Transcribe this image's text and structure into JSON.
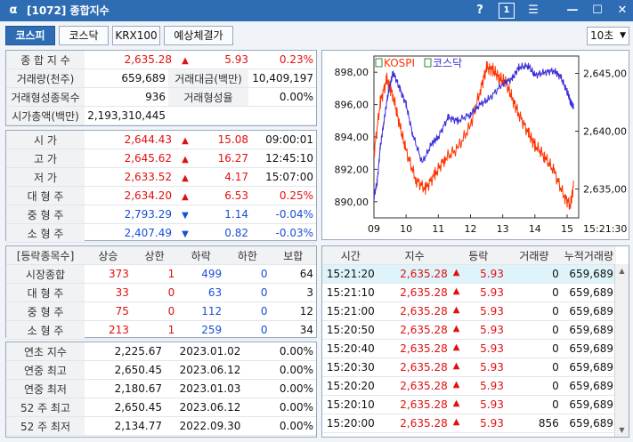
{
  "window": {
    "title": "[1072] 종합지수",
    "logo": "α",
    "help": "?",
    "num": "1",
    "menu": "☰",
    "min": "—",
    "max": "☐",
    "close": "✕"
  },
  "tabs": [
    {
      "label": "코스피"
    },
    {
      "label": "코스닥"
    },
    {
      "label": "KRX100"
    },
    {
      "label": "예상체결가"
    }
  ],
  "interval": {
    "value": "10초"
  },
  "summary": {
    "index_label": "종 합 지 수",
    "index_value": "2,635.28",
    "index_change": "5.93",
    "index_rate": "0.23%",
    "vol_label": "거래량(천주)",
    "vol_value": "659,689",
    "amt_label": "거래대금(백만)",
    "amt_value": "10,409,197",
    "form_cnt_label": "거래형성종목수",
    "form_cnt_value": "936",
    "form_rate_label": "거래형성율",
    "form_rate_value": "0.00%",
    "mcap_label": "시가총액(백만)",
    "mcap_value": "2,193,310,445"
  },
  "ohlc": [
    {
      "label": "시    가",
      "value": "2,644.43",
      "dir": "up",
      "change": "15.08",
      "extra": "09:00:01",
      "vcolor": "red",
      "ecolor": ""
    },
    {
      "label": "고    가",
      "value": "2,645.62",
      "dir": "up",
      "change": "16.27",
      "extra": "12:45:10",
      "vcolor": "red",
      "ecolor": ""
    },
    {
      "label": "저    가",
      "value": "2,633.52",
      "dir": "up",
      "change": "4.17",
      "extra": "15:07:00",
      "vcolor": "red",
      "ecolor": ""
    },
    {
      "label": "대 형 주",
      "value": "2,634.20",
      "dir": "up",
      "change": "6.53",
      "extra": "0.25%",
      "vcolor": "red",
      "ecolor": "red"
    },
    {
      "label": "중 형 주",
      "value": "2,793.29",
      "dir": "down",
      "change": "1.14",
      "extra": "-0.04%",
      "vcolor": "blue",
      "ecolor": "blue"
    },
    {
      "label": "소 형 주",
      "value": "2,407.49",
      "dir": "down",
      "change": "0.82",
      "extra": "-0.03%",
      "vcolor": "blue",
      "ecolor": "blue"
    }
  ],
  "breadth": {
    "headers": [
      "[등락종목수]",
      "상승",
      "상한",
      "하락",
      "하한",
      "보합"
    ],
    "rows": [
      {
        "label": "시장종합",
        "up": "373",
        "upper": "1",
        "down": "499",
        "lower": "0",
        "flat": "64"
      },
      {
        "label": "대 형 주",
        "up": "33",
        "upper": "0",
        "down": "63",
        "lower": "0",
        "flat": "3"
      },
      {
        "label": "중 형 주",
        "up": "75",
        "upper": "0",
        "down": "112",
        "lower": "0",
        "flat": "12"
      },
      {
        "label": "소 형 주",
        "up": "213",
        "upper": "1",
        "down": "259",
        "lower": "0",
        "flat": "34"
      }
    ]
  },
  "hist": [
    {
      "label": "연초  지수",
      "value": "2,225.67",
      "date": "2023.01.02",
      "rate": "0.00%"
    },
    {
      "label": "연중  최고",
      "value": "2,650.45",
      "date": "2023.06.12",
      "rate": "0.00%"
    },
    {
      "label": "연중  최저",
      "value": "2,180.67",
      "date": "2023.01.03",
      "rate": "0.00%"
    },
    {
      "label": "52 주 최고",
      "value": "2,650.45",
      "date": "2023.06.12",
      "rate": "0.00%"
    },
    {
      "label": "52 주 최저",
      "value": "2,134.77",
      "date": "2022.09.30",
      "rate": "0.00%"
    }
  ],
  "ticks": {
    "headers": [
      "시간",
      "지수",
      "등락",
      "거래량",
      "누적거래량"
    ],
    "rows": [
      {
        "time": "15:21:20",
        "index": "2,635.28",
        "change": "5.93",
        "vol": "0",
        "cum": "659,689"
      },
      {
        "time": "15:21:10",
        "index": "2,635.28",
        "change": "5.93",
        "vol": "0",
        "cum": "659,689"
      },
      {
        "time": "15:21:00",
        "index": "2,635.28",
        "change": "5.93",
        "vol": "0",
        "cum": "659,689"
      },
      {
        "time": "15:20:50",
        "index": "2,635.28",
        "change": "5.93",
        "vol": "0",
        "cum": "659,689"
      },
      {
        "time": "15:20:40",
        "index": "2,635.28",
        "change": "5.93",
        "vol": "0",
        "cum": "659,689"
      },
      {
        "time": "15:20:30",
        "index": "2,635.28",
        "change": "5.93",
        "vol": "0",
        "cum": "659,689"
      },
      {
        "time": "15:20:20",
        "index": "2,635.28",
        "change": "5.93",
        "vol": "0",
        "cum": "659,689"
      },
      {
        "time": "15:20:10",
        "index": "2,635.28",
        "change": "5.93",
        "vol": "0",
        "cum": "659,689"
      },
      {
        "time": "15:20:00",
        "index": "2,635.28",
        "change": "5.93",
        "vol": "856",
        "cum": "659,689"
      }
    ]
  },
  "chart_data": {
    "type": "line",
    "series": [
      {
        "name": "KOSPI",
        "color": "#ff3300",
        "axis": "right"
      },
      {
        "name": "코스닥",
        "color": "#3b2fd6",
        "axis": "left"
      }
    ],
    "x_ticks": [
      "09",
      "10",
      "11",
      "12",
      "13",
      "14",
      "15",
      "15:21:30"
    ],
    "left_axis": {
      "ticks": [
        "898,00",
        "896,00",
        "894,00",
        "892,00",
        "890,00"
      ],
      "range": [
        889.0,
        899.0
      ]
    },
    "right_axis": {
      "ticks": [
        "2,645,00",
        "2,640,00",
        "2,635,00"
      ],
      "range": [
        2632.5,
        2646.5
      ]
    },
    "kosdaq_points": [
      [
        9.0,
        890.3
      ],
      [
        9.1,
        891.2
      ],
      [
        9.2,
        893.4
      ],
      [
        9.3,
        894.8
      ],
      [
        9.4,
        896.2
      ],
      [
        9.5,
        897.2
      ],
      [
        9.6,
        898.0
      ],
      [
        9.8,
        897.0
      ],
      [
        10.0,
        896.0
      ],
      [
        10.2,
        894.2
      ],
      [
        10.5,
        892.4
      ],
      [
        10.8,
        893.6
      ],
      [
        11.0,
        894.0
      ],
      [
        11.3,
        895.2
      ],
      [
        11.6,
        895.0
      ],
      [
        12.0,
        895.4
      ],
      [
        12.3,
        896.0
      ],
      [
        12.6,
        896.4
      ],
      [
        13.0,
        897.3
      ],
      [
        13.3,
        897.6
      ],
      [
        13.5,
        898.3
      ],
      [
        13.8,
        898.4
      ],
      [
        14.0,
        897.8
      ],
      [
        14.3,
        898.0
      ],
      [
        14.6,
        898.1
      ],
      [
        14.8,
        897.7
      ],
      [
        15.0,
        896.8
      ],
      [
        15.1,
        896.2
      ],
      [
        15.2,
        895.8
      ]
    ],
    "kospi_points": [
      [
        9.0,
        2638.0
      ],
      [
        9.2,
        2642.5
      ],
      [
        9.4,
        2644.5
      ],
      [
        9.6,
        2643.0
      ],
      [
        9.8,
        2640.5
      ],
      [
        10.0,
        2638.3
      ],
      [
        10.3,
        2635.8
      ],
      [
        10.6,
        2635.0
      ],
      [
        10.9,
        2636.3
      ],
      [
        11.2,
        2637.6
      ],
      [
        11.6,
        2638.5
      ],
      [
        12.0,
        2640.5
      ],
      [
        12.3,
        2643.5
      ],
      [
        12.5,
        2645.5
      ],
      [
        12.7,
        2645.3
      ],
      [
        12.9,
        2644.6
      ],
      [
        13.1,
        2644.2
      ],
      [
        13.3,
        2642.8
      ],
      [
        13.5,
        2641.5
      ],
      [
        13.8,
        2639.8
      ],
      [
        14.0,
        2638.8
      ],
      [
        14.3,
        2637.8
      ],
      [
        14.6,
        2636.5
      ],
      [
        14.9,
        2634.4
      ],
      [
        15.1,
        2633.6
      ],
      [
        15.2,
        2635.3
      ]
    ]
  }
}
